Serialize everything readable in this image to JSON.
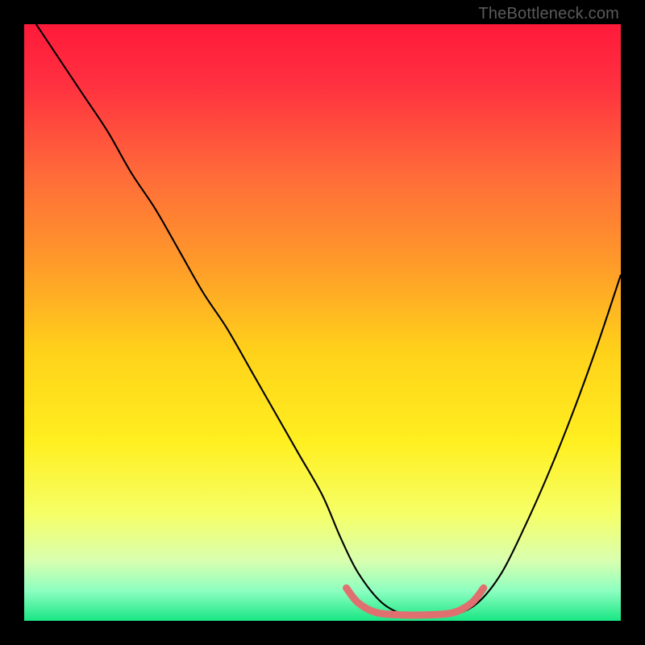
{
  "watermark": "TheBottleneck.com",
  "chart_data": {
    "type": "line",
    "title": "",
    "xlabel": "",
    "ylabel": "",
    "xlim": [
      0,
      100
    ],
    "ylim": [
      0,
      100
    ],
    "grid": false,
    "legend": false,
    "background_gradient_stops": [
      {
        "offset": 0.0,
        "color": "#ff1a3a"
      },
      {
        "offset": 0.1,
        "color": "#ff3040"
      },
      {
        "offset": 0.25,
        "color": "#ff6a3a"
      },
      {
        "offset": 0.4,
        "color": "#ff9a2a"
      },
      {
        "offset": 0.55,
        "color": "#ffd21a"
      },
      {
        "offset": 0.7,
        "color": "#ffef20"
      },
      {
        "offset": 0.82,
        "color": "#f6ff66"
      },
      {
        "offset": 0.9,
        "color": "#d8ffb0"
      },
      {
        "offset": 0.95,
        "color": "#8cffc0"
      },
      {
        "offset": 1.0,
        "color": "#19e684"
      }
    ],
    "series": [
      {
        "name": "bottleneck-curve",
        "stroke": "#000000",
        "stroke_width": 2.1,
        "x": [
          2,
          6,
          10,
          14,
          18,
          22,
          26,
          30,
          34,
          38,
          42,
          46,
          50,
          53,
          56,
          60,
          64,
          68,
          72,
          76,
          80,
          84,
          88,
          92,
          96,
          100
        ],
        "y": [
          100,
          94,
          88,
          82,
          75,
          69,
          62,
          55,
          49,
          42,
          35,
          28,
          21,
          14,
          8,
          3,
          1,
          1,
          1,
          3,
          8,
          16,
          25,
          35,
          46,
          58
        ]
      },
      {
        "name": "bottom-highlight",
        "stroke": "#e07070",
        "stroke_width": 9,
        "linecap": "round",
        "x": [
          54,
          56,
          59,
          63,
          68,
          72,
          75,
          77
        ],
        "y": [
          5.5,
          3.0,
          1.4,
          1.0,
          1.0,
          1.4,
          3.0,
          5.5
        ]
      }
    ],
    "annotations": []
  }
}
